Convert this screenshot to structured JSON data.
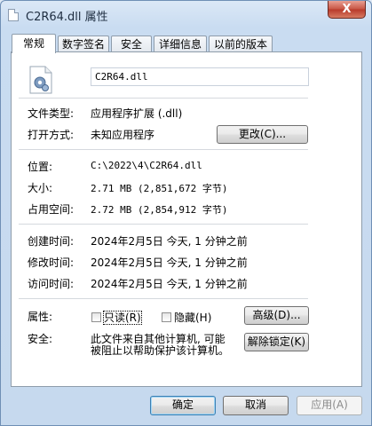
{
  "window": {
    "title": "C2R64.dll 属性",
    "close_glyph": "X"
  },
  "tabs": [
    "常规",
    "数字签名",
    "安全",
    "详细信息",
    "以前的版本"
  ],
  "general": {
    "file_name": "C2R64.dll",
    "file_type_label": "文件类型:",
    "file_type_value": "应用程序扩展 (.dll)",
    "open_with_label": "打开方式:",
    "open_with_value": "未知应用程序",
    "change_button": "更改(C)...",
    "location_label": "位置:",
    "location_value": "C:\\2022\\4\\C2R64.dll",
    "size_label": "大小:",
    "size_value": "2.71 MB (2,851,672 字节)",
    "size_on_disk_label": "占用空间:",
    "size_on_disk_value": "2.72 MB (2,854,912 字节)",
    "created_label": "创建时间:",
    "created_value": "2024年2月5日 今天, 1 分钟之前",
    "modified_label": "修改时间:",
    "modified_value": "2024年2月5日 今天, 1 分钟之前",
    "accessed_label": "访问时间:",
    "accessed_value": "2024年2月5日 今天, 1 分钟之前",
    "attributes_label": "属性:",
    "readonly_label": "只读(R)",
    "hidden_label": "隐藏(H)",
    "advanced_button": "高级(D)...",
    "security_label": "安全:",
    "security_line1": "此文件来自其他计算机, 可能",
    "security_line2": "被阻止以帮助保护该计算机。",
    "unblock_button": "解除锁定(K)"
  },
  "footer": {
    "ok": "确定",
    "cancel": "取消",
    "apply": "应用(A)"
  }
}
